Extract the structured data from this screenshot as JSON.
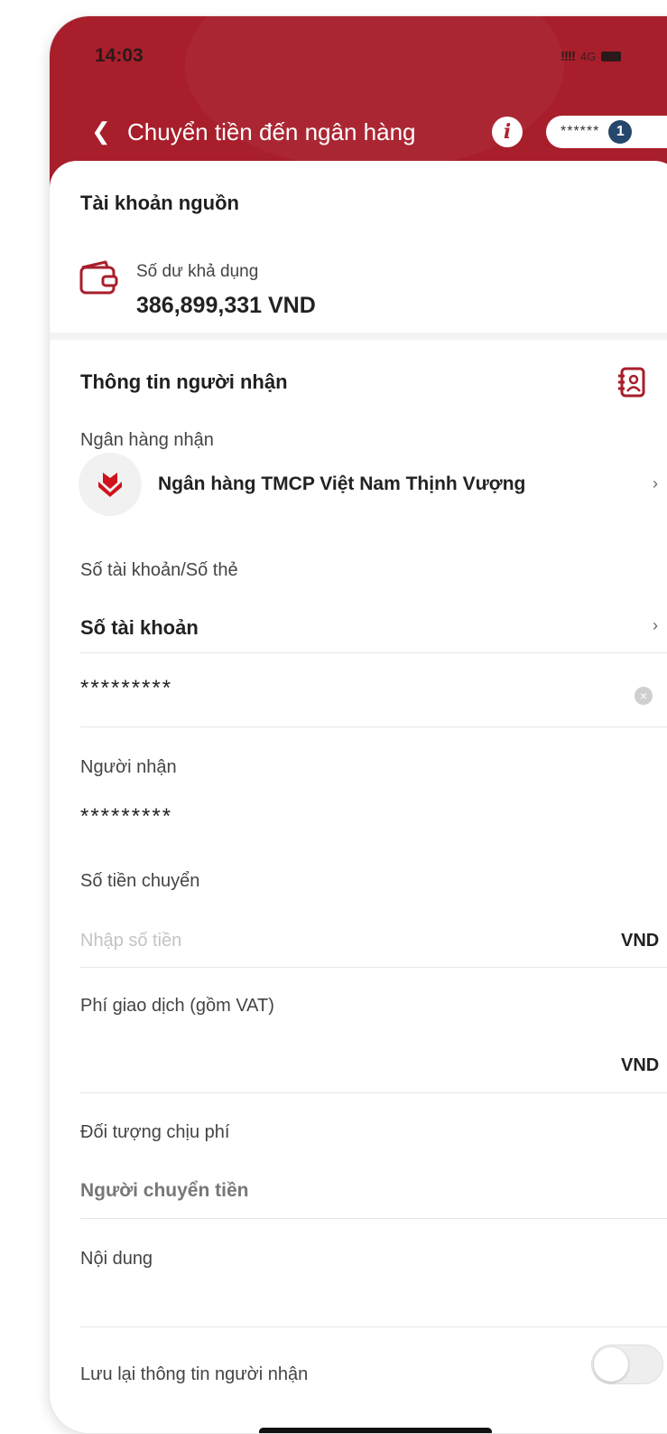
{
  "status_bar": {
    "time": "14:03",
    "signal": "!!!!",
    "network": "4G"
  },
  "header": {
    "title": "Chuyển tiền đến ngân hàng",
    "info_label": "i",
    "account_mask": "******",
    "account_index": "1"
  },
  "source": {
    "section_title": "Tài khoản nguồn",
    "balance_label": "Số dư khả dụng",
    "balance_value": "386,899,331 VND"
  },
  "recipient": {
    "section_title": "Thông tin người nhận",
    "bank_label": "Ngân hàng nhận",
    "bank_name": "Ngân hàng TMCP Việt Nam Thịnh Vượng",
    "account_type_label": "Số tài khoản/Số thẻ",
    "account_type_value": "Số tài khoản",
    "account_number": "*********",
    "name_label": "Người nhận",
    "name_value": "*********"
  },
  "transfer": {
    "amount_label": "Số tiền chuyển",
    "amount_placeholder": "Nhập số tiền",
    "amount_currency": "VND",
    "fee_label": "Phí giao dịch (gồm VAT)",
    "fee_currency": "VND",
    "fee_payer_label": "Đối tượng chịu phí",
    "fee_payer_value": "Người chuyển tiền",
    "content_label": "Nội dung",
    "save_label": "Lưu lại thông tin người nhận",
    "save_enabled": false
  },
  "colors": {
    "brand": "#a81e2b",
    "accent": "#24476b"
  }
}
